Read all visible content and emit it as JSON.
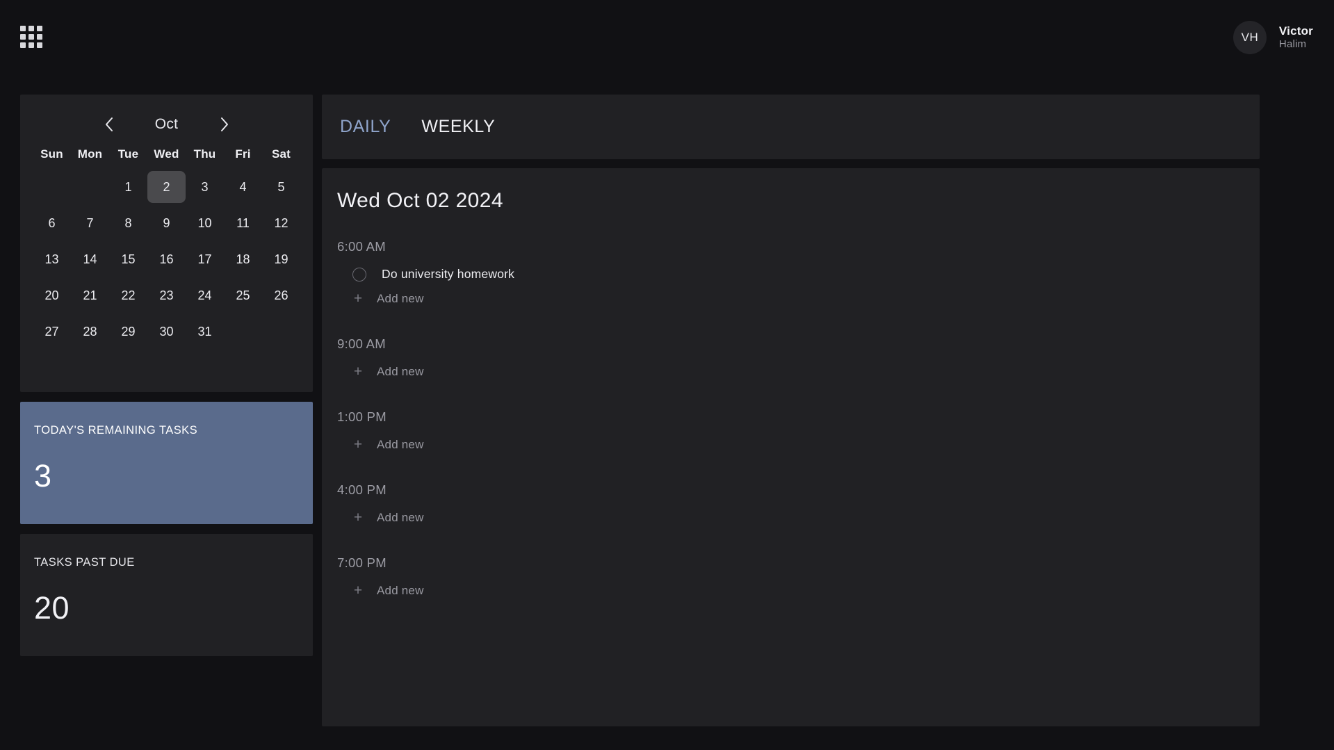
{
  "topbar": {
    "menu_icon": "grid-menu-icon",
    "user": {
      "initials": "VH",
      "first_name": "Victor",
      "last_name": "Halim"
    }
  },
  "calendar": {
    "month": "Oct",
    "prev_icon": "chevron-left-icon",
    "next_icon": "chevron-right-icon",
    "weekdays": [
      "Sun",
      "Mon",
      "Tue",
      "Wed",
      "Thu",
      "Fri",
      "Sat"
    ],
    "selected_day": "2",
    "weeks": [
      [
        "",
        "",
        "1",
        "2",
        "3",
        "4",
        "5"
      ],
      [
        "6",
        "7",
        "8",
        "9",
        "10",
        "11",
        "12"
      ],
      [
        "13",
        "14",
        "15",
        "16",
        "17",
        "18",
        "19"
      ],
      [
        "20",
        "21",
        "22",
        "23",
        "24",
        "25",
        "26"
      ],
      [
        "27",
        "28",
        "29",
        "30",
        "31",
        "",
        ""
      ]
    ]
  },
  "stats": {
    "remaining": {
      "title": "TODAY'S REMAINING TASKS",
      "value": "3",
      "bg_color": "#5a6b8c"
    },
    "past_due": {
      "title": "TASKS PAST DUE",
      "value": "20",
      "bg_color": "#212124"
    }
  },
  "tabs": {
    "items": [
      {
        "label": "DAILY",
        "active": true
      },
      {
        "label": "WEEKLY",
        "active": false
      }
    ],
    "active_color": "#8fa4cb"
  },
  "day_view": {
    "date_title": "Wed Oct 02 2024",
    "add_new_label": "Add new",
    "slots": [
      {
        "time": "6:00 AM",
        "tasks": [
          {
            "label": "Do university homework",
            "done": false
          }
        ]
      },
      {
        "time": "9:00 AM",
        "tasks": []
      },
      {
        "time": "1:00 PM",
        "tasks": []
      },
      {
        "time": "4:00 PM",
        "tasks": []
      },
      {
        "time": "7:00 PM",
        "tasks": []
      }
    ]
  }
}
